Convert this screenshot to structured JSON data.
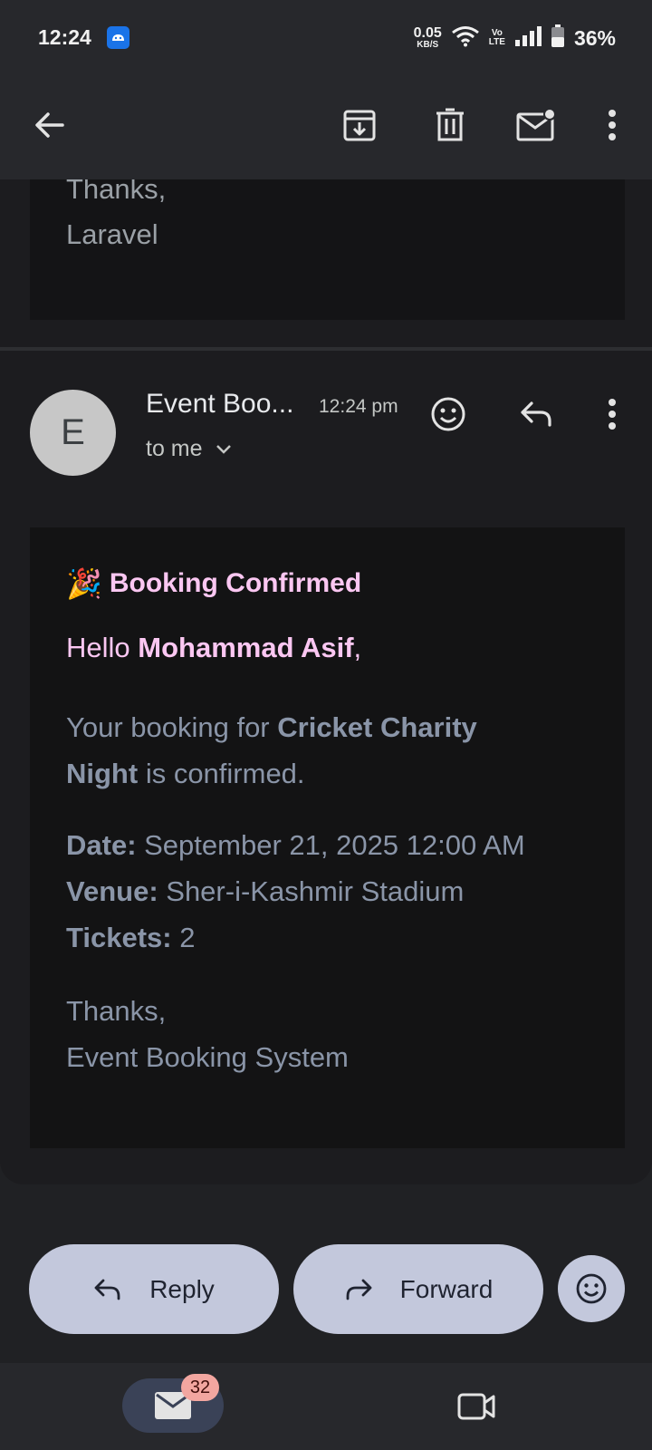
{
  "status_bar": {
    "time": "12:24",
    "net_speed": "0.05",
    "net_unit": "KB/S",
    "volte_top": "Vo",
    "volte_bottom": "LTE",
    "battery": "36%"
  },
  "toolbar": {
    "icons": [
      "back-arrow-icon",
      "archive-icon",
      "delete-icon",
      "mark-unread-icon",
      "more-vert-icon"
    ]
  },
  "previous_message": {
    "text": "Thanks,\nLaravel"
  },
  "message": {
    "avatar_initial": "E",
    "sender": "Event Boo...",
    "time": "12:24 pm",
    "recipient": "to me",
    "title_emoji": "🎉",
    "title": "Booking Confirmed",
    "greeting_prefix": "Hello ",
    "greeting_name": "Mohammad Asif",
    "greeting_suffix": ",",
    "booking_prefix": "Your booking for ",
    "event_name": "Cricket Charity Night",
    "booking_suffix": " is confirmed.",
    "date_label": "Date:",
    "date_value": " September 21, 2025 12:00 AM",
    "venue_label": "Venue:",
    "venue_value": " Sher-i-Kashmir Stadium",
    "tickets_label": "Tickets:",
    "tickets_value": " 2",
    "sign_thanks": "Thanks,",
    "sign_name": "Event Booking System"
  },
  "actions": {
    "reply_label": "Reply",
    "forward_label": "Forward"
  },
  "bottom_nav": {
    "mail_badge": "32"
  },
  "colors": {
    "accent_pink": "#fbc7f2",
    "button_bg": "#c3c8dc",
    "body_bg": "#131314"
  }
}
